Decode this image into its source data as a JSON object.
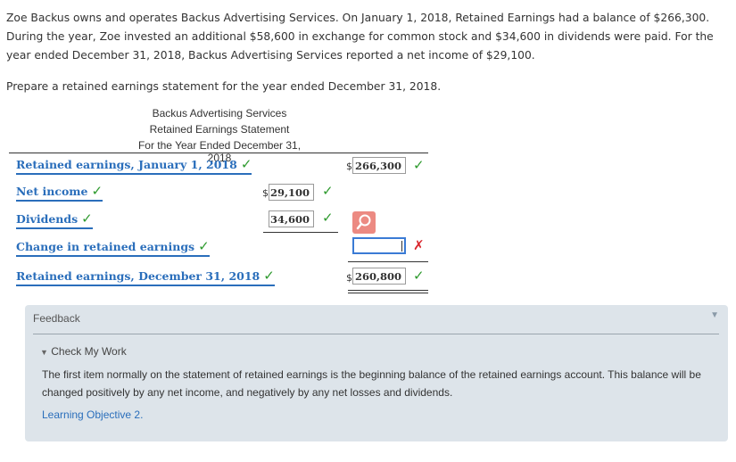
{
  "problem": {
    "text": "Zoe Backus owns and operates Backus Advertising Services. On January 1, 2018, Retained Earnings had a balance of $266,300. During the year, Zoe invested an additional $58,600 in exchange for common stock and $34,600 in dividends were paid. For the year ended December 31, 2018, Backus Advertising Services reported a net income of $29,100.",
    "prompt": "Prepare a retained earnings statement for the year ended December 31, 2018."
  },
  "statement": {
    "company": "Backus Advertising Services",
    "title": "Retained Earnings Statement",
    "period": "For the Year Ended December 31, 2018",
    "rows": [
      {
        "label": "Retained earnings, January 1, 2018",
        "value": "266,300",
        "status": "correct"
      },
      {
        "label": "Net income",
        "value": "29,100",
        "status": "correct"
      },
      {
        "label": "Dividends",
        "value": "34,600",
        "status": "correct"
      },
      {
        "label": "Change in retained earnings",
        "value": "",
        "status": "incorrect"
      },
      {
        "label": "Retained earnings, December 31, 2018",
        "value": "260,800",
        "status": "correct"
      }
    ],
    "dollar_sign": "$",
    "check_glyph": "✓",
    "x_glyph": "✗"
  },
  "feedback": {
    "title": "Feedback",
    "section": "Check My Work",
    "text": "The first item normally on the statement of retained earnings is the beginning balance of the retained earnings account. This balance will be changed positively by any net income, and negatively by any net losses and dividends.",
    "link": "Learning Objective 2.",
    "collapse_glyph": "▼",
    "expand_glyph": "▼"
  },
  "icons": {
    "magnifier": "magnifier-icon"
  },
  "colors": {
    "label_blue": "#2a6ebb",
    "correct_green": "#2e9a2e",
    "incorrect_red": "#d9262c",
    "feedback_bg": "#dde4ea",
    "magnifier_bg": "#ec8a82"
  }
}
